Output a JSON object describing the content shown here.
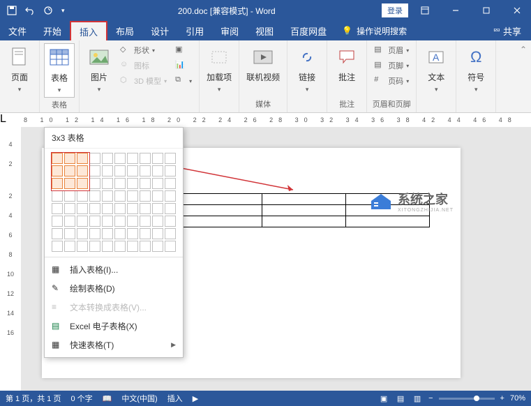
{
  "titlebar": {
    "doc_name": "200.doc [兼容模式] - Word",
    "login": "登录"
  },
  "tabs": {
    "file": "文件",
    "home": "开始",
    "insert": "插入",
    "layout": "布局",
    "design": "设计",
    "references": "引用",
    "review": "审阅",
    "view": "视图",
    "baidu": "百度网盘",
    "tell_me": "操作说明搜索",
    "share": "共享"
  },
  "ribbon": {
    "page": {
      "label": "页面"
    },
    "table": {
      "label": "表格",
      "group": "表格"
    },
    "image": {
      "label": "图片"
    },
    "shapes": "形状",
    "icons": "图标",
    "models": "3D 模型",
    "addin": {
      "label": "加载项"
    },
    "video": {
      "label": "联机视频",
      "group": "媒体"
    },
    "link": {
      "label": "链接"
    },
    "comment": {
      "label": "批注",
      "group": "批注"
    },
    "header": "页眉",
    "footer": "页脚",
    "pagenum": "页码",
    "hf_group": "页眉和页脚",
    "textbox": {
      "label": "文本"
    },
    "symbol": {
      "label": "符号"
    }
  },
  "dropdown": {
    "title": "3x3 表格",
    "insert_table": "插入表格(I)...",
    "draw_table": "绘制表格(D)",
    "text_to_table": "文本转换成表格(V)...",
    "excel": "Excel 电子表格(X)",
    "quick_tables": "快速表格(T)"
  },
  "ruler_h": "8 10 12 14 16 18 20 22 24 26 28 30 32 34 36 38   42 44 46 48",
  "ruler_v": [
    "4",
    "2",
    "",
    "2",
    "4",
    "6",
    "8",
    "10",
    "12",
    "14",
    "16"
  ],
  "watermark": {
    "main": "系统之家",
    "sub": "XITONGZHIJIA.NET"
  },
  "statusbar": {
    "page": "第 1 页，共 1 页",
    "words": "0 个字",
    "lang": "中文(中国)",
    "mode": "插入",
    "zoom": "70%"
  }
}
